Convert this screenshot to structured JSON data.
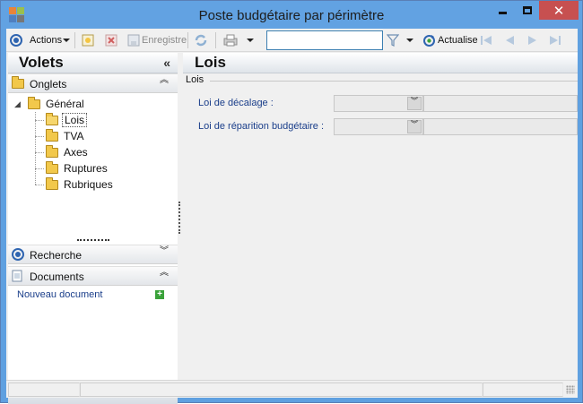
{
  "window": {
    "title": "Poste budgétaire par périmètre",
    "controls": {
      "minimize": "",
      "maximize": "",
      "close": "✕"
    },
    "accent": "#62a2e2",
    "close_color": "#c75050"
  },
  "toolbar": {
    "actions_label": "Actions",
    "save_label": "Enregistre",
    "search_value": "",
    "refresh_label": "Actualise"
  },
  "left_panel": {
    "title": "Volets",
    "collapse_glyph": "«",
    "sections": {
      "onglets": {
        "label": "Onglets",
        "chevron": "︽"
      },
      "recherche": {
        "label": "Recherche",
        "chevron": "︾"
      },
      "documents": {
        "label": "Documents",
        "chevron": "︽"
      }
    },
    "tree": {
      "expander": "◢",
      "root": "Général",
      "children": [
        "Lois",
        "TVA",
        "Axes",
        "Ruptures",
        "Rubriques"
      ],
      "selected": "Lois"
    },
    "new_document": "Nouveau document",
    "new_document_glyph": "+",
    "footer_chevron": "▼"
  },
  "main": {
    "title": "Lois",
    "group_label": "Lois",
    "fields": [
      {
        "label": "Loi de décalage :",
        "value": ""
      },
      {
        "label": "Loi de réparition budgétaire :",
        "value": ""
      }
    ],
    "combo_glyph": "︾"
  }
}
